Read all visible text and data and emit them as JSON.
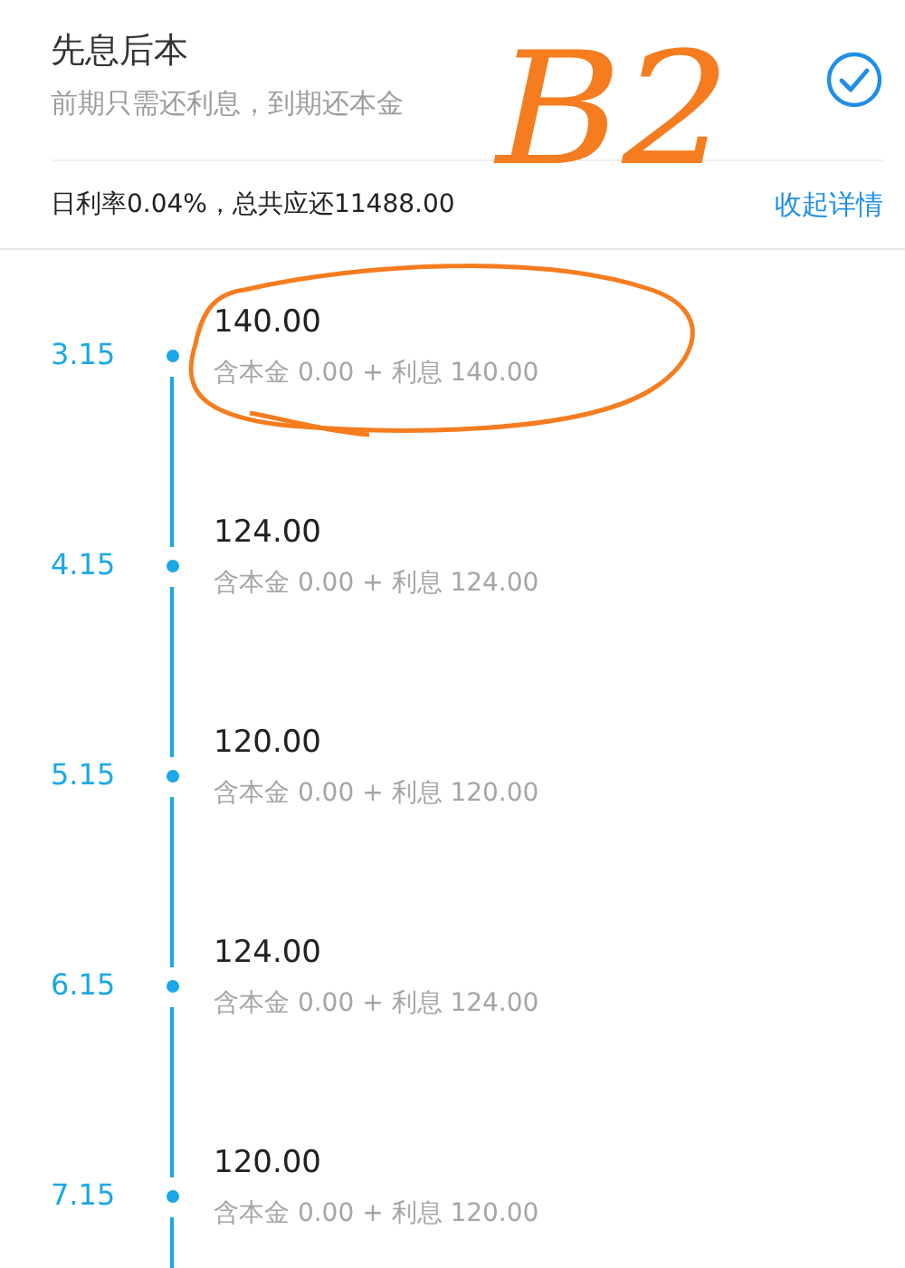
{
  "plan": {
    "title": "先息后本",
    "subtitle": "前期只需还利息，到期还本金",
    "checked": true
  },
  "summary": {
    "text": "日利率0.04%，总共应还11488.00",
    "toggle": "收起详情"
  },
  "schedule": [
    {
      "date": "3.15",
      "amount": "140.00",
      "detail": "含本金 0.00 + 利息 140.00"
    },
    {
      "date": "4.15",
      "amount": "124.00",
      "detail": "含本金 0.00 + 利息 124.00"
    },
    {
      "date": "5.15",
      "amount": "120.00",
      "detail": "含本金 0.00 + 利息 120.00"
    },
    {
      "date": "6.15",
      "amount": "124.00",
      "detail": "含本金 0.00 + 利息 124.00"
    },
    {
      "date": "7.15",
      "amount": "120.00",
      "detail": "含本金 0.00 + 利息 120.00"
    }
  ],
  "annotation": {
    "text": "B2"
  }
}
